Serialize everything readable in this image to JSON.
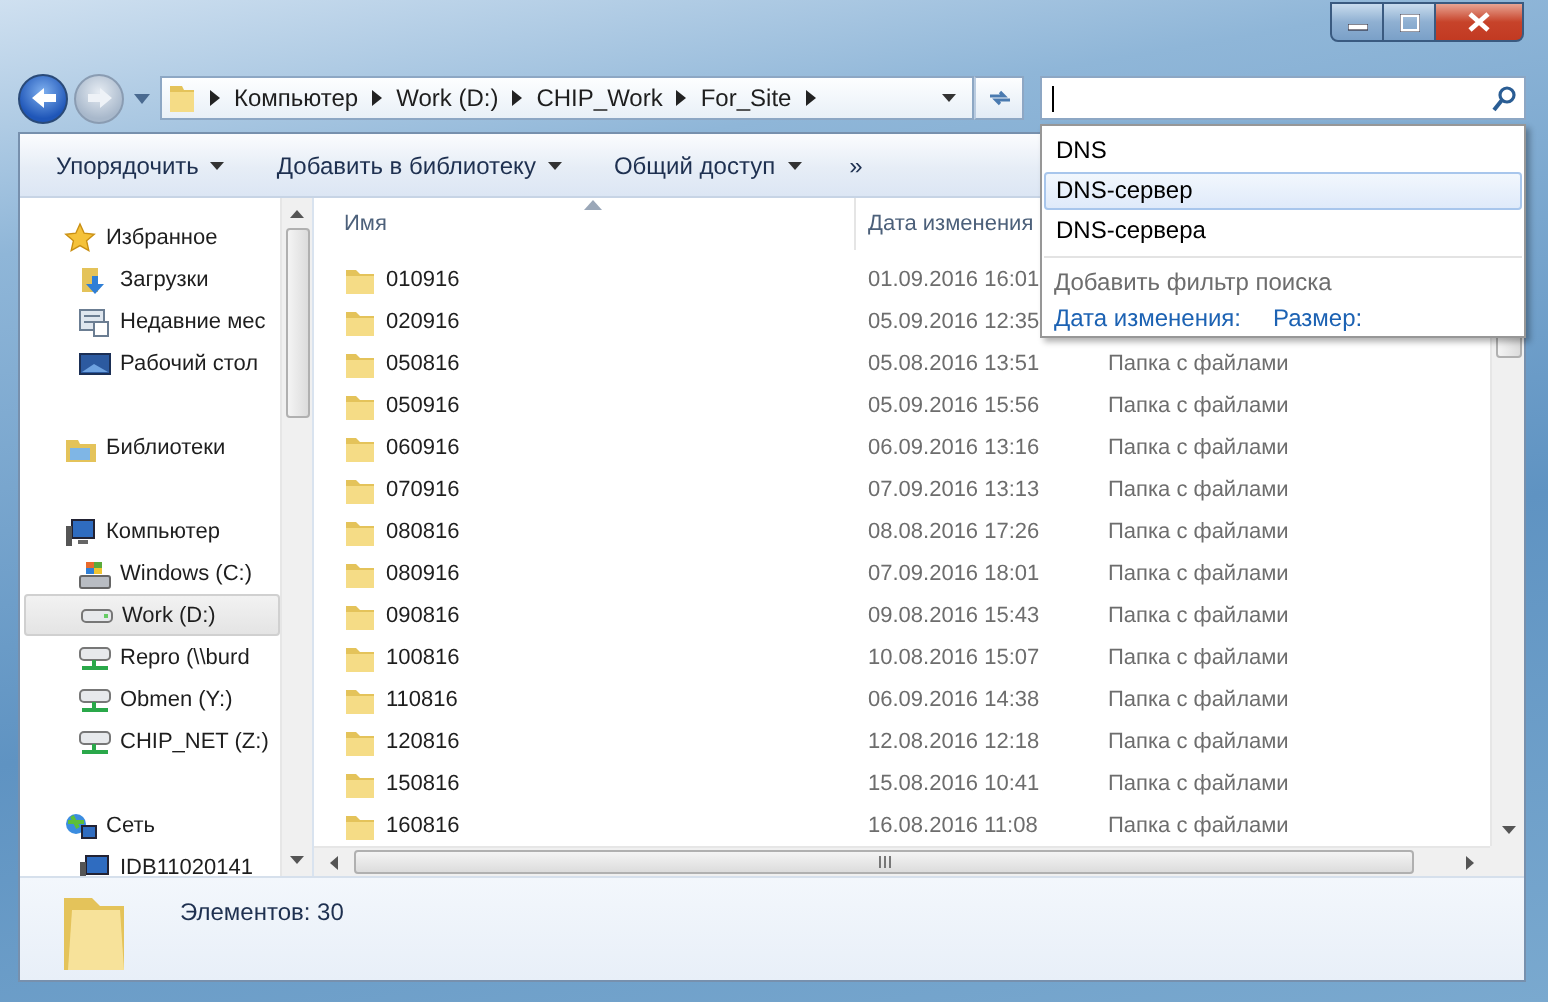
{
  "address_bar": {
    "breadcrumbs": [
      "Компьютер",
      "Work (D:)",
      "CHIP_Work",
      "For_Site"
    ]
  },
  "search": {
    "suggestions": [
      {
        "label": "DNS",
        "selected": false
      },
      {
        "label": "DNS-сервер",
        "selected": true
      },
      {
        "label": "DNS-сервера",
        "selected": false
      }
    ],
    "filter_hint": "Добавить фильтр поиска",
    "filters": [
      "Дата изменения:",
      "Размер:"
    ]
  },
  "toolbar": {
    "items": [
      {
        "label": "Упорядочить"
      },
      {
        "label": "Добавить в библиотеку"
      },
      {
        "label": "Общий доступ"
      }
    ],
    "overflow": "»"
  },
  "nav": {
    "sections": [
      {
        "label": "Избранное",
        "kind": "star",
        "selected": false,
        "children": [
          {
            "label": "Загрузки",
            "kind": "download",
            "selected": false
          },
          {
            "label": "Недавние мес",
            "kind": "recent",
            "selected": false
          },
          {
            "label": "Рабочий стол",
            "kind": "desktop",
            "selected": false
          }
        ]
      },
      {
        "label": "Библиотеки",
        "kind": "library",
        "selected": false
      },
      {
        "label": "Компьютер",
        "kind": "computer",
        "selected": false,
        "children": [
          {
            "label": "Windows (C:)",
            "kind": "system-drive",
            "selected": false
          },
          {
            "label": "Work (D:)",
            "kind": "drive",
            "selected": true
          },
          {
            "label": "Repro (\\\\burd",
            "kind": "network-drive",
            "selected": false
          },
          {
            "label": "Obmen (Y:)",
            "kind": "network-drive",
            "selected": false
          },
          {
            "label": "CHIP_NET (Z:)",
            "kind": "network-drive",
            "selected": false
          }
        ]
      },
      {
        "label": "Сеть",
        "kind": "network",
        "selected": false,
        "children": [
          {
            "label": "IDB11020141",
            "kind": "computer",
            "selected": false
          }
        ]
      }
    ]
  },
  "table": {
    "columns": [
      "Имя",
      "Дата изменения"
    ],
    "rows": [
      {
        "name": "010916",
        "date": "01.09.2016 16:01"
      },
      {
        "name": "020916",
        "date": "05.09.2016 12:35"
      },
      {
        "name": "050816",
        "date": "05.08.2016 13:51",
        "type": "Папка с файлами"
      },
      {
        "name": "050916",
        "date": "05.09.2016 15:56",
        "type": "Папка с файлами"
      },
      {
        "name": "060916",
        "date": "06.09.2016 13:16",
        "type": "Папка с файлами"
      },
      {
        "name": "070916",
        "date": "07.09.2016 13:13",
        "type": "Папка с файлами"
      },
      {
        "name": "080816",
        "date": "08.08.2016 17:26",
        "type": "Папка с файлами"
      },
      {
        "name": "080916",
        "date": "07.09.2016 18:01",
        "type": "Папка с файлами"
      },
      {
        "name": "090816",
        "date": "09.08.2016 15:43",
        "type": "Папка с файлами"
      },
      {
        "name": "100816",
        "date": "10.08.2016 15:07",
        "type": "Папка с файлами"
      },
      {
        "name": "110816",
        "date": "06.09.2016 14:38",
        "type": "Папка с файлами"
      },
      {
        "name": "120816",
        "date": "12.08.2016 12:18",
        "type": "Папка с файлами"
      },
      {
        "name": "150816",
        "date": "15.08.2016 10:41",
        "type": "Папка с файлами"
      },
      {
        "name": "160816",
        "date": "16.08.2016 11:08",
        "type": "Папка с файлами"
      }
    ]
  },
  "status_bar": {
    "text": "Элементов: 30"
  }
}
